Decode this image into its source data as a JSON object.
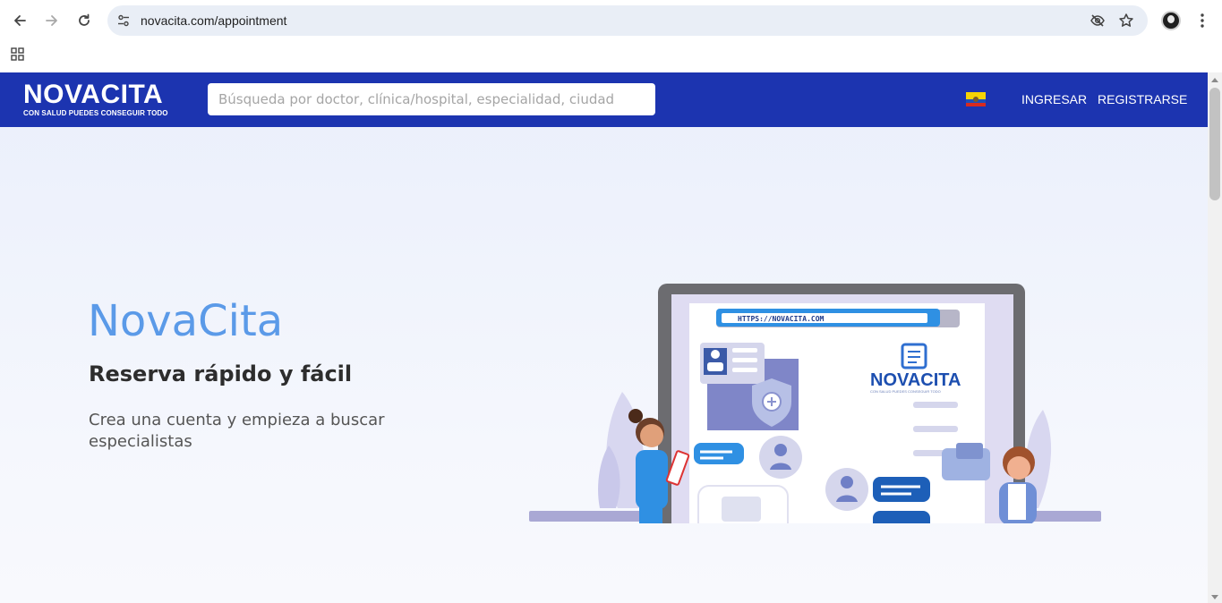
{
  "browser": {
    "url": "novacita.com/appointment",
    "icons": [
      "back-arrow-icon",
      "forward-arrow-icon",
      "reload-icon",
      "site-settings-icon",
      "eye-off-icon",
      "star-icon",
      "profile-icon",
      "more-vert-icon",
      "apps-grid-icon"
    ]
  },
  "header": {
    "logo_text": "NOVACITA",
    "logo_tagline": "CON SALUD PUEDES CONSEGUIR TODO",
    "search_placeholder": "Búsqueda por doctor, clínica/hospital, especialidad, ciudad",
    "login_label": "INGRESAR",
    "register_label": "REGISTRARSE",
    "flag_icon": "ecuador-flag-icon",
    "colors": {
      "brand": "#1c34b0",
      "accent": "#5b9ae8"
    }
  },
  "hero": {
    "title": "NovaCita",
    "subtitle": "Reserva rápido y fácil",
    "description": "Crea una cuenta y empieza a buscar especialistas"
  },
  "illustration": {
    "url_text": "HTTPS://NOVACITA.COM",
    "logo_text": "NOVACITA",
    "logo_tagline": "CON SALUD PUEDES CONSEGUIR TODO"
  }
}
